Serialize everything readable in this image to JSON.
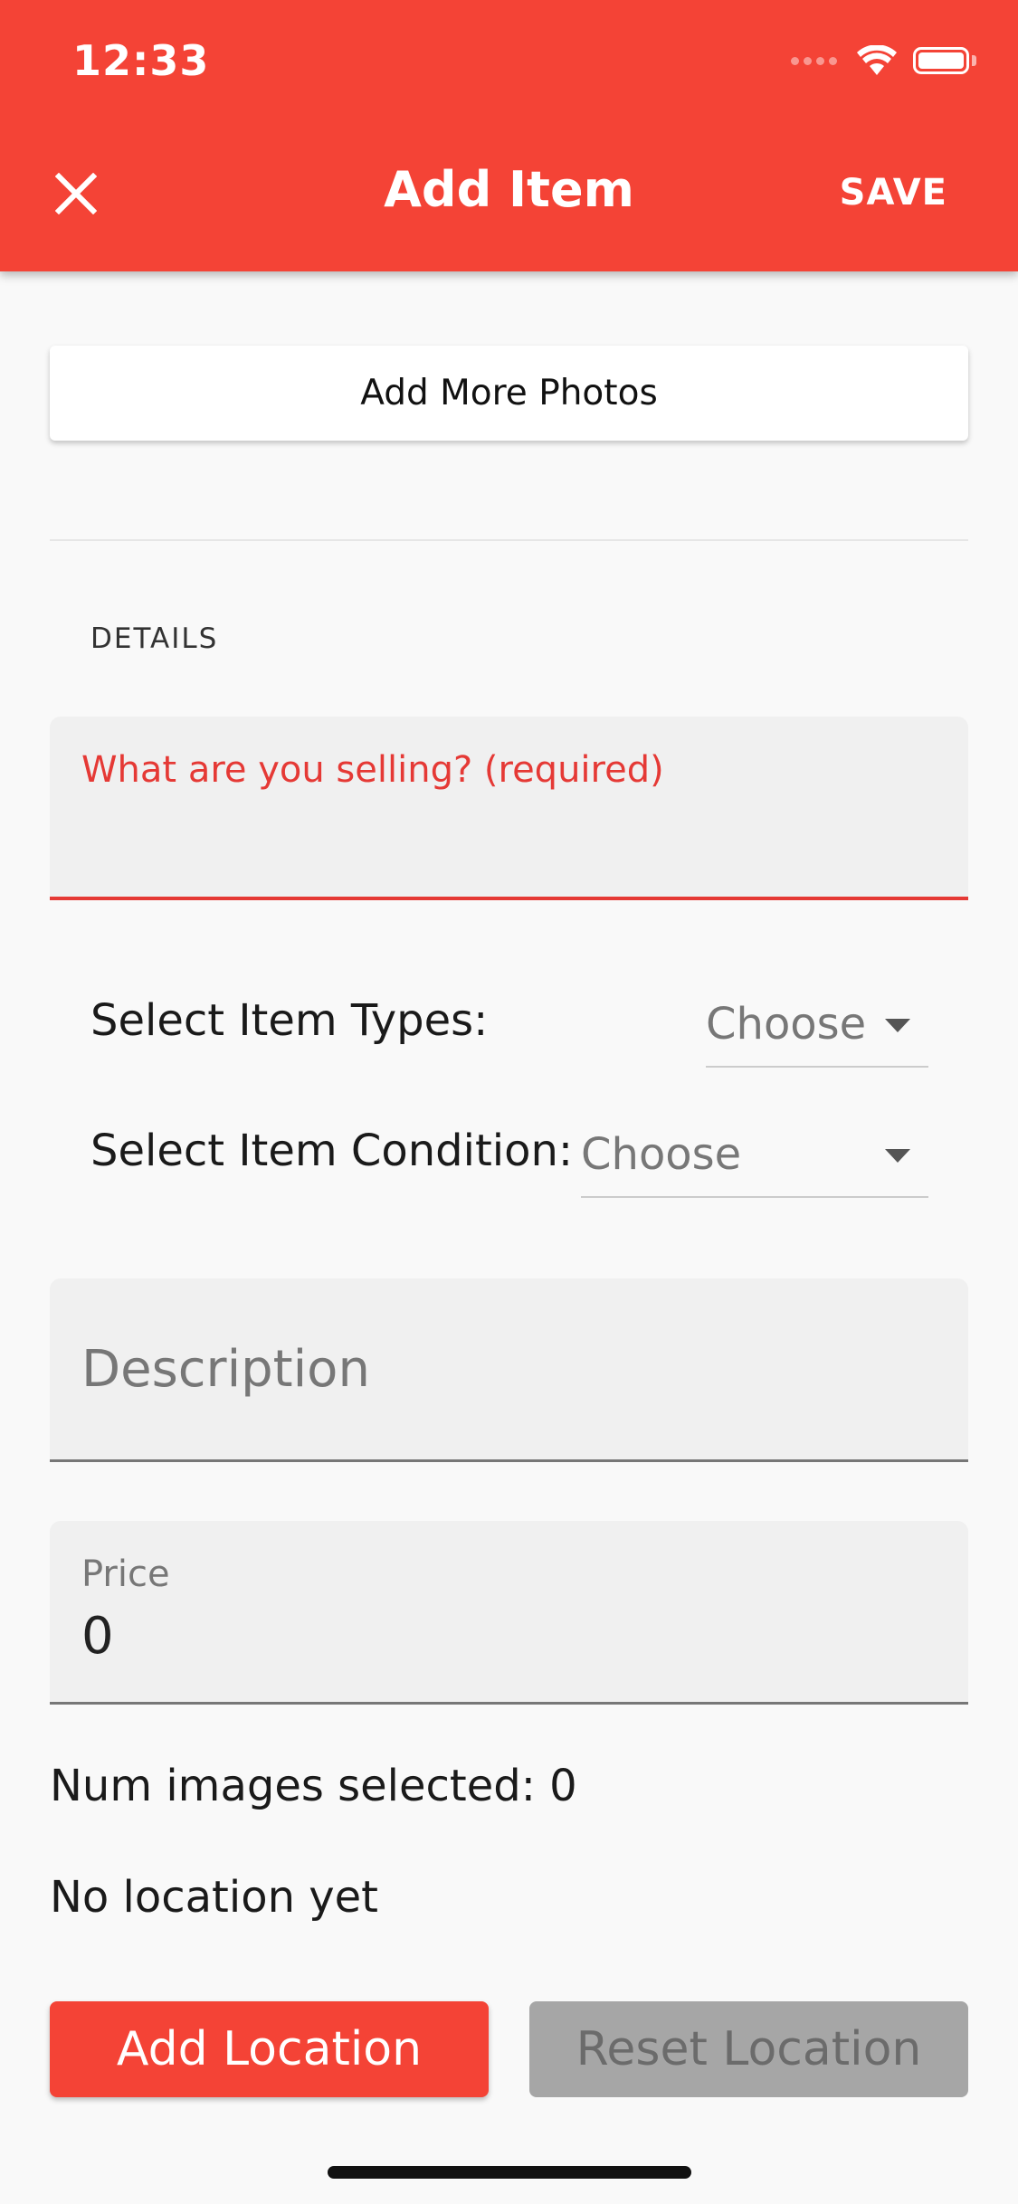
{
  "status_bar": {
    "time": "12:33"
  },
  "app_bar": {
    "title": "Add Item",
    "save_label": "SAVE",
    "close_icon": "close-icon"
  },
  "photos": {
    "button_label": "Add More Photos"
  },
  "details": {
    "header": "DETAILS",
    "what_label": "What are you selling? (required)"
  },
  "item_types": {
    "label": "Select Item Types:",
    "value": "Choose"
  },
  "item_condition": {
    "label": "Select Item Condition:",
    "value": "Choose"
  },
  "description": {
    "label": "Description"
  },
  "price": {
    "label": "Price",
    "value": "0"
  },
  "info": {
    "num_images": "Num images selected: 0",
    "location": "No location yet"
  },
  "actions": {
    "add_location": "Add Location",
    "reset_location": "Reset Location"
  },
  "colors": {
    "accent": "#f44336",
    "error": "#e53935",
    "background": "#f9f9f9",
    "disabled": "#a6a6a6"
  }
}
